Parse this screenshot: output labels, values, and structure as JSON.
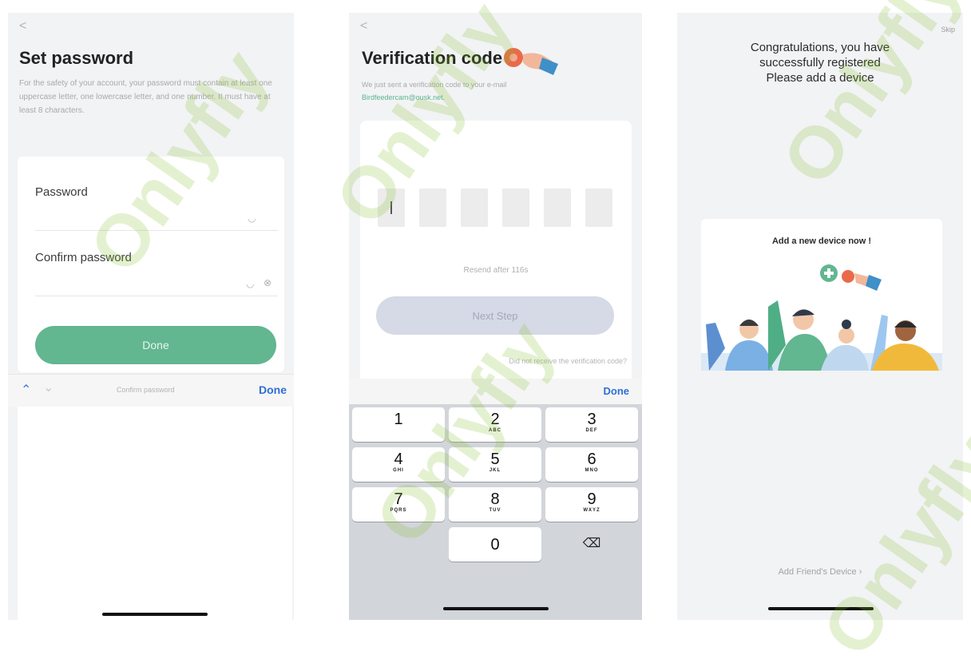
{
  "screen1": {
    "back": "<",
    "title": "Set password",
    "description": "For the safety of your account, your password must contain at least one uppercase letter, one lowercase letter, and one number. It must have at least 8 characters.",
    "password_label": "Password",
    "confirm_label": "Confirm password",
    "done_button": "Done",
    "keyboard_hint": "Confirm password",
    "keyboard_done": "Done"
  },
  "screen2": {
    "back": "<",
    "title": "Verification code",
    "description": "We just sent a verification code to your e-mail",
    "email": "Birdfeedercam@ousk.net.",
    "resend": "Resend after 116s",
    "next_button": "Next Step",
    "not_received": "Did not receive the verification code?",
    "keypad_done": "Done",
    "keys": [
      {
        "num": "1",
        "sub": ""
      },
      {
        "num": "2",
        "sub": "ABC"
      },
      {
        "num": "3",
        "sub": "DEF"
      },
      {
        "num": "4",
        "sub": "GHI"
      },
      {
        "num": "5",
        "sub": "JKL"
      },
      {
        "num": "6",
        "sub": "MNO"
      },
      {
        "num": "7",
        "sub": "PQRS"
      },
      {
        "num": "8",
        "sub": "TUV"
      },
      {
        "num": "9",
        "sub": "WXYZ"
      },
      {
        "num": "0",
        "sub": ""
      }
    ]
  },
  "screen3": {
    "skip": "Skip",
    "congrats_line1": "Congratulations, you have",
    "congrats_line2": "successfully registered",
    "congrats_line3": "Please add a device",
    "card_title": "Add a new device now !",
    "add_friend": "Add Friend's Device"
  },
  "watermark": "Onlyfly",
  "colors": {
    "accent_green": "#62b690",
    "email_green": "#5cb48f",
    "link_blue": "#2f6fd6"
  }
}
